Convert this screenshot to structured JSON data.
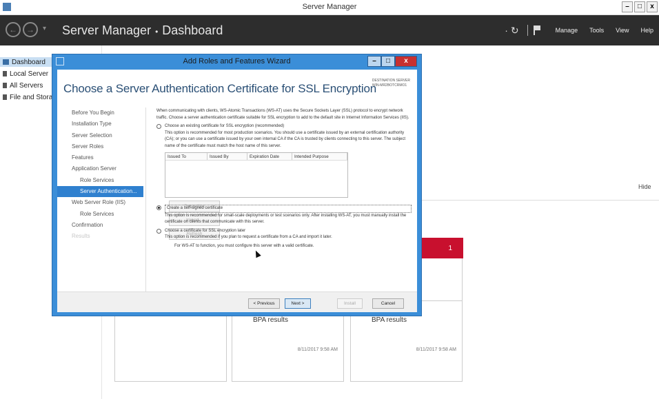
{
  "window": {
    "title": "Server Manager",
    "controls": [
      "–",
      "□",
      "x"
    ]
  },
  "header": {
    "back": "←",
    "forward": "→",
    "dropdown": "▾",
    "breadcrumb_root": "Server Manager",
    "breadcrumb_sep": "•",
    "breadcrumb_page": "Dashboard",
    "refresh": "· ↻",
    "menu": [
      "Manage",
      "Tools",
      "View",
      "Help"
    ]
  },
  "left_nav": [
    {
      "label": "Dashboard"
    },
    {
      "label": "Local Server"
    },
    {
      "label": "All Servers"
    },
    {
      "label": "File and Storage Services"
    }
  ],
  "dashboard": {
    "hide": "Hide",
    "tile_count": "1",
    "bpa_results": "BPA results",
    "timestamp": "8/11/2017 9:58 AM"
  },
  "wizard": {
    "title": "Add Roles and Features Wizard",
    "controls": [
      "–",
      "□",
      "x"
    ],
    "heading": "Choose a Server Authentication Certificate for SSL Encryption",
    "destination_label": "DESTINATION SERVER",
    "destination_server": "WIN-MR2BOTCRMO1",
    "steps": [
      {
        "label": "Before You Begin",
        "level": 0,
        "state": "normal"
      },
      {
        "label": "Installation Type",
        "level": 0,
        "state": "normal"
      },
      {
        "label": "Server Selection",
        "level": 0,
        "state": "normal"
      },
      {
        "label": "Server Roles",
        "level": 0,
        "state": "normal"
      },
      {
        "label": "Features",
        "level": 0,
        "state": "normal"
      },
      {
        "label": "Application Server",
        "level": 0,
        "state": "normal"
      },
      {
        "label": "Role Services",
        "level": 1,
        "state": "normal"
      },
      {
        "label": "Server Authentication...",
        "level": 1,
        "state": "current"
      },
      {
        "label": "Web Server Role (IIS)",
        "level": 0,
        "state": "normal"
      },
      {
        "label": "Role Services",
        "level": 1,
        "state": "normal"
      },
      {
        "label": "Confirmation",
        "level": 0,
        "state": "normal"
      },
      {
        "label": "Results",
        "level": 0,
        "state": "disabled"
      }
    ],
    "intro": "When communicating with clients, WS-Atomic Transactions (WS-AT) uses the Secure Sockets Layer (SSL) protocol to encrypt network traffic. Choose a server authentication certificate suitable for SSL encryption to add to the default site in Internet Information Services (IIS).",
    "option_existing": {
      "label": "Choose an existing certificate for SSL encryption (recommended)",
      "desc": "This option is recommended for most production scenarios. You should use a certificate issued by an external certification authority (CA); or you can use a certificate issued by your own internal CA if the CA is trusted by clients connecting to this server. The subject name of the certificate must match the host name of this server."
    },
    "table_headers": [
      "Issued To",
      "Issued By",
      "Expiration Date",
      "Intended Purpose"
    ],
    "cert_buttons": [
      "Properties",
      "Import...",
      "Refresh"
    ],
    "option_self_signed": {
      "label": "Create a self-signed certificate",
      "desc": "This option is recommended for small-scale deployments or test scenarios only. After installing WS-AT, you must manually install the certificate on clients that communicate with this server."
    },
    "option_later": {
      "label": "Choose a certificate for SSL encryption later",
      "desc": "This option is recommended if you plan to request a certificate from a CA and import it later.",
      "note": "For WS-AT to function, you must configure this server with a valid certificate."
    },
    "footer": {
      "previous": "< Previous",
      "next": "Next >",
      "install": "Install",
      "cancel": "Cancel"
    }
  }
}
